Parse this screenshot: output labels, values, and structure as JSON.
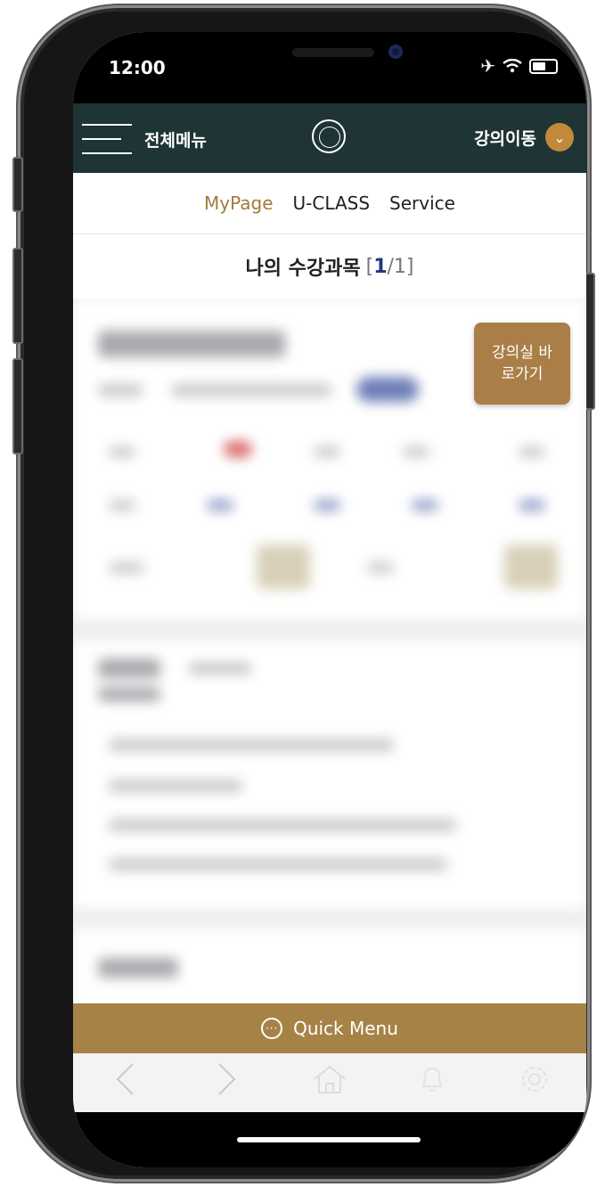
{
  "status_bar": {
    "time": "12:00",
    "airplane_icon": "airplane-icon",
    "wifi_icon": "wifi-icon",
    "battery_icon": "battery-icon"
  },
  "header": {
    "menu_label": "전체메뉴",
    "move_label": "강의이동"
  },
  "tabs": [
    {
      "label": "MyPage"
    },
    {
      "label": "U-CLASS"
    },
    {
      "label": "Service"
    }
  ],
  "page_title": {
    "text": "나의 수강과목",
    "current": "1",
    "total": "1"
  },
  "shortcut_button": {
    "line1": "강의실 바",
    "line2": "로가기"
  },
  "quick_menu": {
    "label": "Quick Menu"
  },
  "colors": {
    "header_bg": "#1f3434",
    "accent": "#a78246",
    "tab_active": "#a27a3e"
  }
}
